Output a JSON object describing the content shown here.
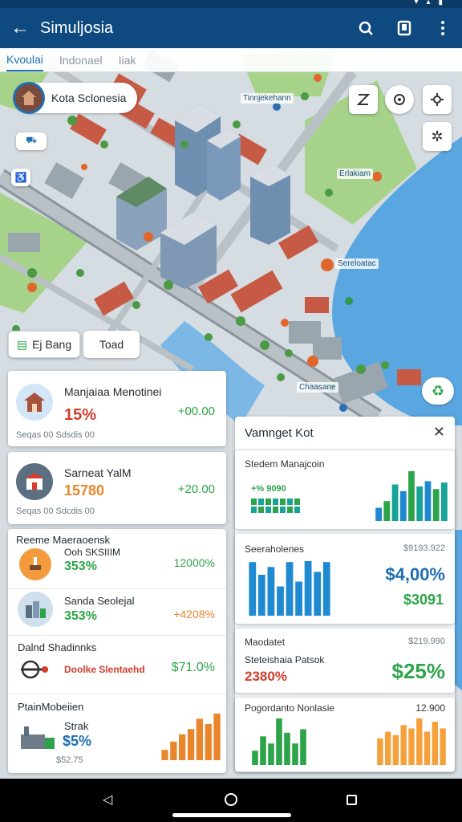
{
  "app": {
    "title": "Simuljosia",
    "tabs": [
      {
        "label": "Kvoulai",
        "active": true
      },
      {
        "label": "Indonael",
        "active": false
      },
      {
        "label": "Iiak",
        "active": false
      }
    ]
  },
  "map": {
    "location_chip": "Kota Sclonesia",
    "labels": [
      "Tinnjekehann",
      "Erlakiam",
      "Sereloatac",
      "Chaasane"
    ],
    "buttons": {
      "btn1": "Ej Bang",
      "btn2": "Toad"
    }
  },
  "cards_left": [
    {
      "title": "Manjaiaa Menotinei",
      "pct": "15%",
      "value": "+00.00",
      "footer": "Seqas 00  Sdsdis 00",
      "icon": "home-icon",
      "pct_color": "red"
    },
    {
      "title": "Sarneat YalM",
      "pct": "15780",
      "value": "+20.00",
      "footer": "Seqas 00  Sdcdis 00",
      "icon": "shop-icon",
      "pct_color": "orange"
    }
  ],
  "group_card": {
    "title": "Reeme Maeraoensk",
    "rows": [
      {
        "sub": "Ooh SKSIIIM",
        "pct": "353%",
        "value": "12000%",
        "icon": "brush-icon",
        "pct_color": "green",
        "value_color": "green"
      },
      {
        "sub": "Sanda Seolejal",
        "pct": "353%",
        "value": "+4208%",
        "icon": "city-icon",
        "pct_color": "green",
        "value_color": "orange"
      },
      {
        "title": "Dalnd Shadinnks",
        "sub": "Doolke Slentaehd",
        "value": "$71.0%",
        "icon": "tools-icon",
        "sub_color": "red",
        "value_color": "green"
      },
      {
        "title": "PtainMobeiien",
        "sub": "Strak",
        "pct": "$5%",
        "footer": "$52.75",
        "icon": "factory-icon",
        "pct_color": "blue"
      }
    ]
  },
  "popup": {
    "title": "Vamnget Kot",
    "cards": [
      {
        "title": "Stedem Manajcoin",
        "legend": "+% 9090"
      },
      {
        "title": "Seeraholenes",
        "top_value": "$9193.922",
        "value": "$4,00%",
        "sub_value": "$3091"
      },
      {
        "title": "Maodatet",
        "top_value": "$219.990",
        "subtitle": "Steteishaia Patsok",
        "pct": "2380%",
        "value": "$25%"
      },
      {
        "title": "Pogordanto Nonlasie",
        "top_value": "12.900"
      }
    ]
  },
  "chart_data": [
    {
      "type": "bar",
      "series": [
        {
          "values": [
            20,
            30,
            55,
            45,
            75,
            52,
            60,
            48,
            58
          ]
        }
      ]
    },
    {
      "type": "bar",
      "series": [
        {
          "values": [
            55,
            42,
            50,
            30,
            55,
            35,
            56,
            45,
            55
          ]
        }
      ]
    },
    {
      "type": "bar",
      "series": [
        {
          "values": [
            20,
            40,
            30,
            65,
            45,
            30,
            50
          ]
        }
      ]
    },
    {
      "type": "bar",
      "series": [
        {
          "values": [
            40,
            50,
            45,
            60,
            55,
            70,
            50,
            65,
            55
          ]
        }
      ]
    },
    {
      "type": "bar",
      "series": [
        {
          "values": [
            10,
            18,
            25,
            30,
            40,
            35,
            45
          ]
        }
      ]
    }
  ],
  "colors": {
    "primary": "#0e4a80",
    "accent": "#1f6fb2",
    "green": "#2ea44a",
    "red": "#d43c2c",
    "orange": "#e9862b",
    "water": "#5aa6e0",
    "park": "#a6d28a"
  }
}
